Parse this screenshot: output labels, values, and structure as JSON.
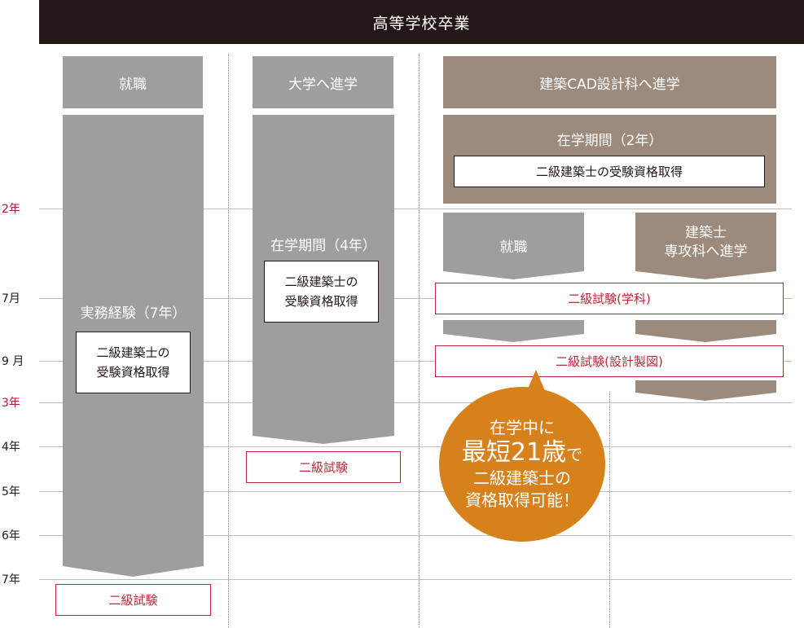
{
  "header": {
    "title": "高等学校卒業"
  },
  "y_axis": [
    {
      "label": "2年",
      "highlight": true
    },
    {
      "label": "7月",
      "highlight": false
    },
    {
      "label": "9 月",
      "highlight": false
    },
    {
      "label": "3年",
      "highlight": true
    },
    {
      "label": "4年",
      "highlight": false
    },
    {
      "label": "5年",
      "highlight": false
    },
    {
      "label": "6年",
      "highlight": false
    },
    {
      "label": "7年",
      "highlight": false
    }
  ],
  "col1": {
    "title": "就職",
    "period": "実務経験（7年）",
    "goal_line1": "二級建築士の",
    "goal_line2": "受験資格取得",
    "exam": "二級試験"
  },
  "col2": {
    "title": "大学へ進学",
    "period": "在学期間（4年）",
    "goal_line1": "二級建築士の",
    "goal_line2": "受験資格取得",
    "exam": "二級試験"
  },
  "col3": {
    "title": "建築CAD設計科へ進学",
    "period": "在学期間（2年）",
    "goal": "二級建築士の受験資格取得",
    "branch_job": "就職",
    "branch_study_line1": "建築士",
    "branch_study_line2": "専攻科へ進学",
    "exam_1": "二級試験(学科)",
    "exam_2": "二級試験(設計製図)"
  },
  "bubble": {
    "line1": "在学中に",
    "line2_big": "最短21歳",
    "line2_small": "で",
    "line3": "二級建築士の",
    "line4": "資格取得可能！"
  },
  "colors": {
    "header": "#231815",
    "gray": "#9e9e9e",
    "brown": "#9c8a7c",
    "accent_red": "#c0273b",
    "bubble_orange": "#d7811c"
  }
}
